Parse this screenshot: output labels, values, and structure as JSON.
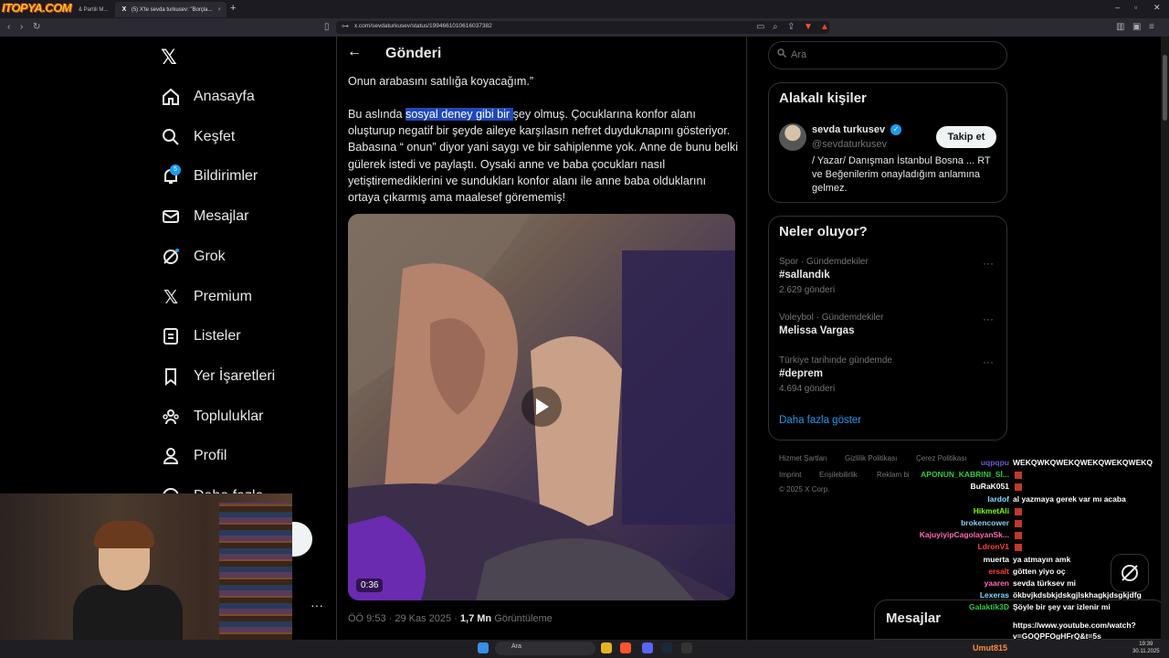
{
  "browser": {
    "overlay_logo": "ITOPYA.COM",
    "tab1_label": "& Partili M...",
    "tab2_label": "(5) X'te sevda turkusev: \"Borçla...",
    "url": "x.com/sevdaturkusev/status/1994661010616037382"
  },
  "nav": {
    "items": [
      {
        "label": "Anasayfa",
        "icon": "home-icon"
      },
      {
        "label": "Keşfet",
        "icon": "search-icon"
      },
      {
        "label": "Bildirimler",
        "icon": "bell-icon"
      },
      {
        "label": "Mesajlar",
        "icon": "mail-icon"
      },
      {
        "label": "Grok",
        "icon": "grok-icon"
      },
      {
        "label": "Premium",
        "icon": "x-icon"
      },
      {
        "label": "Listeler",
        "icon": "list-icon"
      },
      {
        "label": "Yer İşaretleri",
        "icon": "bookmark-icon"
      },
      {
        "label": "Topluluklar",
        "icon": "people-icon"
      },
      {
        "label": "Profil",
        "icon": "person-icon"
      }
    ],
    "notification_count": "5",
    "partial_item": "Daha fazla"
  },
  "post": {
    "header": "Gönderi",
    "line1": "Onun arabasını satılığa koyacağım.”",
    "p2_pre": "Bu aslında ",
    "p2_highlight": "sosyal deney gibi bir ",
    "p2_post": "şey olmuş. Çocuklarına konfor alanı oluşturup negatif bir şeyde aileye karşılasın nefret duydukларını gösteriyor. Babasına “ onun” diyor yani saygı ve bir sahiplenme yok. Anne de bunu belki gülerek istedi ve paylaştı. Oysaki anne ve baba çocukları nasıl yetiştiremediklerini ve sundukları konfor alanı ile anne baba olduklarını ortaya çıkarmış ama maalesef görememiş!",
    "video_duration": "0:36",
    "time": "ÖÖ 9:53 · 29 Kas 2025 · ",
    "views": "1,7 Mn",
    "views_label": " Görüntüleme"
  },
  "right": {
    "search_placeholder": "Ara",
    "related_title": "Alakalı kişiler",
    "person_name": "sevda turkusev",
    "person_handle": "@sevdaturkusev",
    "follow_label": "Takip et",
    "person_bio": "/ Yazar/ Danışman İstanbul Bosna ... RT ve Beğenilerim onayladığım anlamına gelmez.",
    "trends_title": "Neler oluyor?",
    "trends": [
      {
        "category": "Spor · Gündemdekiler",
        "name": "#sallandık",
        "count": "2.629 gönderi"
      },
      {
        "category": "Voleybol · Gündemdekiler",
        "name": "Melissa Vargas",
        "count": ""
      },
      {
        "category": "Türkiye tarihinde gündemde",
        "name": "#deprem",
        "count": "4.694 gönderi"
      }
    ],
    "show_more": "Daha fazla göster",
    "footer": [
      "Hizmet Şartları",
      "Gizlilik Politikası",
      "Çerez Politikası",
      "Imprint",
      "Erişilebilirlik",
      "Reklam bi",
      "© 2025 X Corp."
    ],
    "messages_label": "Mesajlar"
  },
  "chat": [
    {
      "user": "uqpqpu",
      "color": "#6a5acd",
      "msg": "WEKQWKQWEKQWEKQWEKQWEKQ"
    },
    {
      "user": "APONUN_KABRINI_Sİ...",
      "color": "#2ecc40",
      "msg": ""
    },
    {
      "user": "BuRaK051",
      "color": "#ffffff",
      "msg": ""
    },
    {
      "user": "lardof",
      "color": "#7fdbff",
      "msg": "al yazmaya gerek var mı acaba"
    },
    {
      "user": "HikmetAli",
      "color": "#7cfc00",
      "msg": ""
    },
    {
      "user": "brokencower",
      "color": "#87ceeb",
      "msg": ""
    },
    {
      "user": "KajuyiyipCagolayanSk...",
      "color": "#ff69b4",
      "msg": ""
    },
    {
      "user": "LdronV1",
      "color": "#ff4136",
      "msg": ""
    },
    {
      "user": "muerta",
      "color": "#ffffff",
      "msg": "ya atmayın amk"
    },
    {
      "user": "ersalt",
      "color": "#ff4136",
      "msg": "götten yiyo oç"
    },
    {
      "user": "yaaren",
      "color": "#ff69b4",
      "msg": "sevda türksev mi"
    },
    {
      "user": "Lexeras",
      "color": "#7fdbff",
      "msg": "ökbvjkdsbkjdskgjlskhagkjdsgkjdfg"
    },
    {
      "user": "Galaktik3D",
      "color": "#2ecc40",
      "msg": "Şöyle bir şey var izlenir mi"
    }
  ],
  "chat_extra": [
    "https://www.youtube.com/watch?",
    "v=GOQPFOgHFrQ&t=5s"
  ],
  "taskbar": {
    "search": "Ara",
    "user": "Umut815",
    "time": "19:39",
    "date": "30.11.2025"
  }
}
